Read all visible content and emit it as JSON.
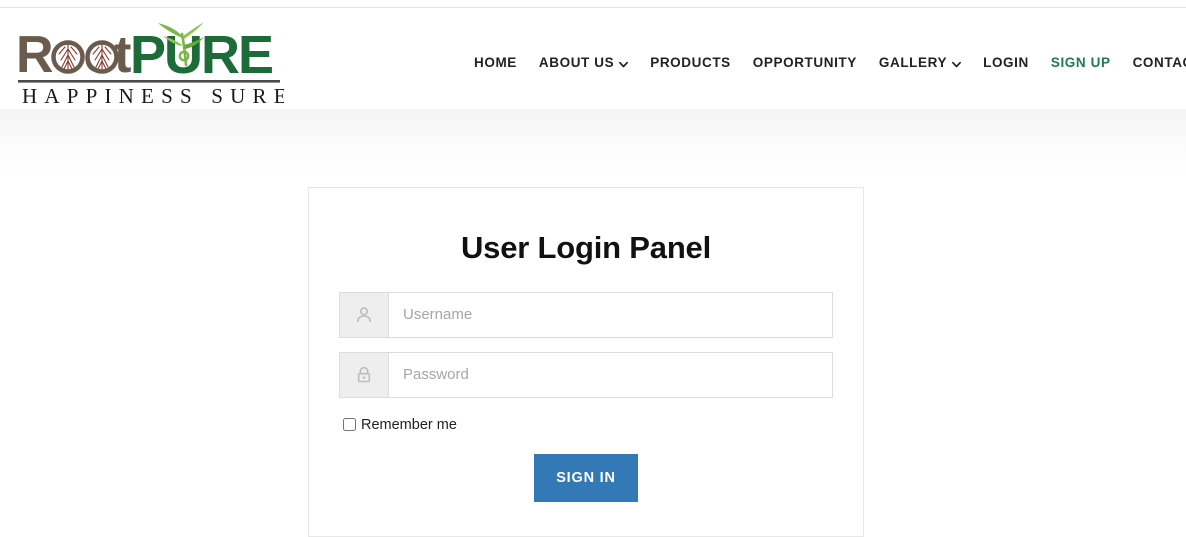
{
  "brand": {
    "name_part_one": "Root",
    "name_part_two": "PURE",
    "tagline": "HAPPINESS SURE",
    "colors": {
      "root_brown": "#6b5b4d",
      "pure_green": "#1c6b38",
      "leaf_green": "#7ab648",
      "root_art": "#8b3a2a"
    }
  },
  "nav": {
    "items": [
      {
        "label": "HOME",
        "has_caret": false,
        "accent": false
      },
      {
        "label": "ABOUT US",
        "has_caret": true,
        "accent": false
      },
      {
        "label": "PRODUCTS",
        "has_caret": false,
        "accent": false
      },
      {
        "label": "OPPORTUNITY",
        "has_caret": false,
        "accent": false
      },
      {
        "label": "GALLERY",
        "has_caret": true,
        "accent": false
      },
      {
        "label": "LOGIN",
        "has_caret": false,
        "accent": false
      },
      {
        "label": "SIGN UP",
        "has_caret": false,
        "accent": true
      },
      {
        "label": "CONTACT",
        "has_caret": false,
        "accent": false
      }
    ],
    "accent_color": "#1f7a4d"
  },
  "login": {
    "title": "User Login Panel",
    "username": {
      "value": "",
      "placeholder": "Username",
      "icon": "user-icon"
    },
    "password": {
      "value": "",
      "placeholder": "Password",
      "icon": "lock-icon"
    },
    "remember": {
      "label": "Remember me",
      "checked": false
    },
    "submit": {
      "label": "SIGN IN",
      "color": "#3379b5"
    }
  }
}
